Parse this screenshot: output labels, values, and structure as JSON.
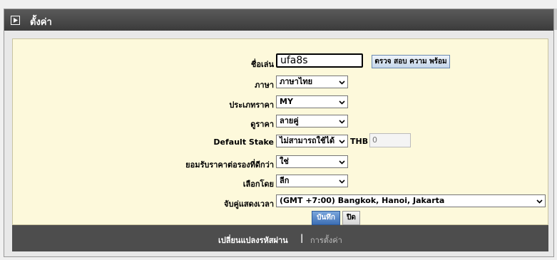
{
  "window": {
    "title": "ตั้งค่า"
  },
  "form": {
    "username": {
      "label": "ชื่อเล่น",
      "value": "ufa8s"
    },
    "check_button": "ตรวจ สอบ ความ พร้อม",
    "language": {
      "label": "ภาษา",
      "value": "ภาษาไทย"
    },
    "odds_type": {
      "label": "ประเภทราคา",
      "value": "MY"
    },
    "odds_view": {
      "label": "ดูราคา",
      "value": "ลายคู่"
    },
    "default_stake": {
      "label": "Default Stake",
      "value": "ไม่สามารถใช้ได้",
      "currency": "THB",
      "amount": "0"
    },
    "accept_better_odds": {
      "label": "ยอมรับราคาต่อรองที่ดีกว่า",
      "value": "ใช่"
    },
    "select_by": {
      "label": "เลือกโดย",
      "value": "ลีก"
    },
    "timezone": {
      "label": "จับคู่แสดงเวลา",
      "value": "(GMT +7:00) Bangkok, Hanoi, Jakarta"
    },
    "save_button": "บันทึก",
    "close_button": "ปิด"
  },
  "footer": {
    "change_password": "เปลี่ยนแปลงรหัสผ่าน",
    "separator": "|",
    "settings": "การตั้งค่า"
  },
  "colors": {
    "titlebar": "#3b3b3b",
    "content_bg": "#fdf9db",
    "footer_bg": "#4d4d4d",
    "save_button": "#3d6fb5"
  },
  "icons": {
    "title": "play-box-icon",
    "dropdown": "chevron-down-icon"
  }
}
